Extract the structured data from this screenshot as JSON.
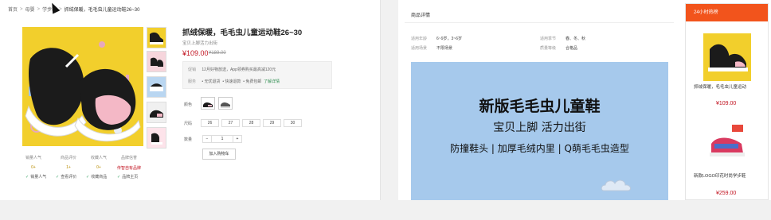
{
  "breadcrumb": {
    "home": "首页",
    "sep": ">",
    "level2": "母婴",
    "level3": "学步鞋",
    "current": "抓绒保暖，毛毛虫儿童运动鞋26~30"
  },
  "product": {
    "title": "抓绒保暖，毛毛虫儿童运动鞋26~30",
    "subtitle": "宝贝上脚活力出街",
    "price": "¥109.00",
    "old_price": "¥189.00",
    "promo": {
      "label": "促销",
      "text": "12月好物放送，App领券购买最高减120元"
    },
    "service": {
      "label": "服务",
      "items": [
        "• 无忧退货",
        "• 快速退款",
        "• 免费包邮"
      ],
      "link": "了解详情"
    },
    "color_label": "颜色",
    "size_label": "尺码",
    "sizes": [
      "26",
      "27",
      "28",
      "29",
      "30"
    ],
    "qty_label": "数量",
    "qty_minus": "−",
    "qty_value": "1",
    "qty_plus": "+",
    "add_to_cart": "加入购物车"
  },
  "stats": [
    {
      "label": "销量人气",
      "value": "0+",
      "accent": "gold"
    },
    {
      "label": "商品评价",
      "value": "1+",
      "accent": "gold"
    },
    {
      "label": "收藏人气",
      "value": "0+",
      "accent": "gold"
    },
    {
      "label": "品牌信誉",
      "value": "传智自有品牌",
      "accent": "red"
    }
  ],
  "services_bottom": [
    "销量人气",
    "查看评价",
    "收藏商品",
    "品牌主页"
  ],
  "details": {
    "tab_title": "商品详情",
    "specs": [
      {
        "k": "适用年龄",
        "v": "6~9岁，3~6岁"
      },
      {
        "k": "适用季节",
        "v": "春、冬、秋"
      },
      {
        "k": "适用场景",
        "v": "不限场景"
      },
      {
        "k": "质量等级",
        "v": "合格品"
      }
    ],
    "banner_line1": "新版毛毛虫儿童鞋",
    "banner_line2": "宝贝上脚 活力出街",
    "banner_line3": "防撞鞋头 | 加厚毛绒内里 | Q萌毛毛虫造型"
  },
  "hot": {
    "title": "24小时热榜",
    "items": [
      {
        "name": "抓绒保暖，毛毛虫儿童运动",
        "price": "¥109.00"
      },
      {
        "name": "新款LOGO印花时尚学步鞋",
        "price": "¥259.00"
      }
    ]
  },
  "colors": {
    "accent_red": "#c1121f",
    "hot_orange": "#f2541c",
    "banner_blue": "#a6c9ec",
    "main_yellow": "#f2cf2c"
  }
}
